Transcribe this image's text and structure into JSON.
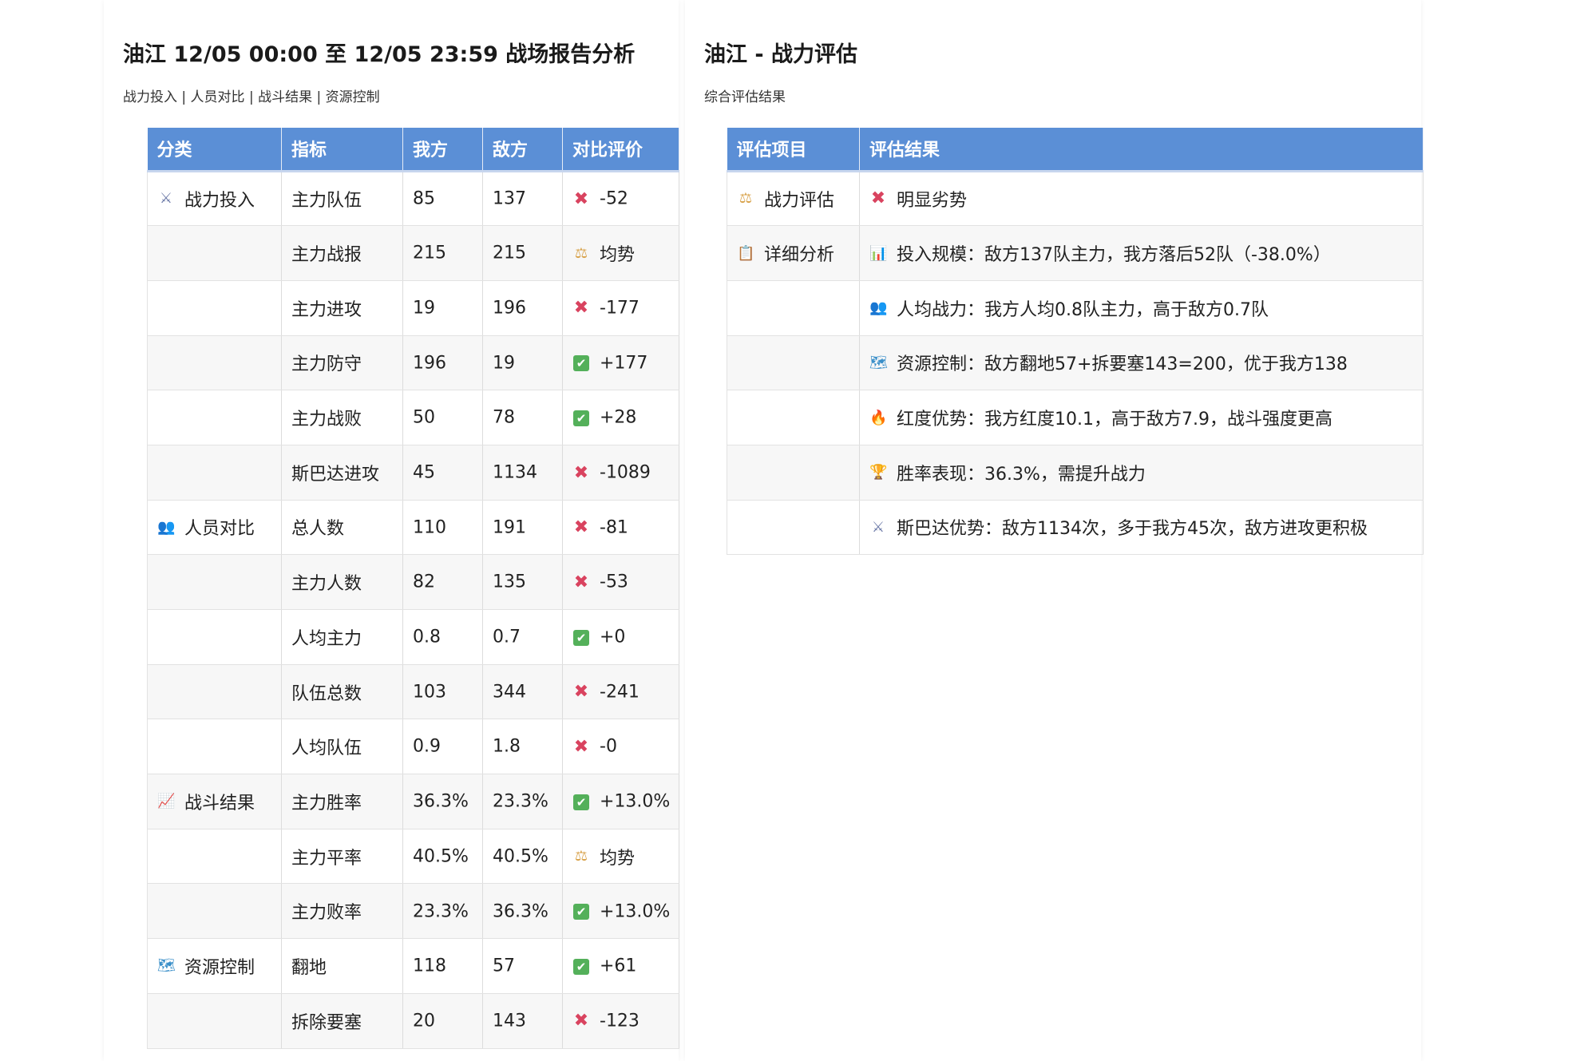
{
  "left": {
    "title": "油江 12/05 00:00 至 12/05 23:59 战场报告分析",
    "subtitle": "战力投入 | 人员对比 | 战斗结果 | 资源控制",
    "headers": [
      "分类",
      "指标",
      "我方",
      "敌方",
      "对比评价"
    ],
    "rows": [
      {
        "category": "战力投入",
        "category_icon": "crossed-swords-icon",
        "metric": "主力队伍",
        "ours": "85",
        "enemy": "137",
        "eval_icon": "cross-mark-icon",
        "eval": "-52"
      },
      {
        "category": "",
        "metric": "主力战报",
        "ours": "215",
        "enemy": "215",
        "eval_icon": "balance-scale-icon",
        "eval": "均势"
      },
      {
        "category": "",
        "metric": "主力进攻",
        "ours": "19",
        "enemy": "196",
        "eval_icon": "cross-mark-icon",
        "eval": "-177"
      },
      {
        "category": "",
        "metric": "主力防守",
        "ours": "196",
        "enemy": "19",
        "eval_icon": "check-mark-icon",
        "eval": "+177"
      },
      {
        "category": "",
        "metric": "主力战败",
        "ours": "50",
        "enemy": "78",
        "eval_icon": "check-mark-icon",
        "eval": "+28"
      },
      {
        "category": "",
        "metric": "斯巴达进攻",
        "ours": "45",
        "enemy": "1134",
        "eval_icon": "cross-mark-icon",
        "eval": "-1089"
      },
      {
        "category": "人员对比",
        "category_icon": "people-icon",
        "metric": "总人数",
        "ours": "110",
        "enemy": "191",
        "eval_icon": "cross-mark-icon",
        "eval": "-81"
      },
      {
        "category": "",
        "metric": "主力人数",
        "ours": "82",
        "enemy": "135",
        "eval_icon": "cross-mark-icon",
        "eval": "-53"
      },
      {
        "category": "",
        "metric": "人均主力",
        "ours": "0.8",
        "enemy": "0.7",
        "eval_icon": "check-mark-icon",
        "eval": "+0"
      },
      {
        "category": "",
        "metric": "队伍总数",
        "ours": "103",
        "enemy": "344",
        "eval_icon": "cross-mark-icon",
        "eval": "-241"
      },
      {
        "category": "",
        "metric": "人均队伍",
        "ours": "0.9",
        "enemy": "1.8",
        "eval_icon": "cross-mark-icon",
        "eval": "-0"
      },
      {
        "category": "战斗结果",
        "category_icon": "chart-increasing-icon",
        "metric": "主力胜率",
        "ours": "36.3%",
        "enemy": "23.3%",
        "eval_icon": "check-mark-icon",
        "eval": "+13.0%"
      },
      {
        "category": "",
        "metric": "主力平率",
        "ours": "40.5%",
        "enemy": "40.5%",
        "eval_icon": "balance-scale-icon",
        "eval": "均势"
      },
      {
        "category": "",
        "metric": "主力败率",
        "ours": "23.3%",
        "enemy": "36.3%",
        "eval_icon": "check-mark-icon",
        "eval": "+13.0%"
      },
      {
        "category": "资源控制",
        "category_icon": "world-map-icon",
        "metric": "翻地",
        "ours": "118",
        "enemy": "57",
        "eval_icon": "check-mark-icon",
        "eval": "+61"
      },
      {
        "category": "",
        "metric": "拆除要塞",
        "ours": "20",
        "enemy": "143",
        "eval_icon": "cross-mark-icon",
        "eval": "-123"
      }
    ]
  },
  "right": {
    "title": "油江 - 战力评估",
    "subtitle": "综合评估结果",
    "headers": [
      "评估项目",
      "评估结果"
    ],
    "rows": [
      {
        "item": "战力评估",
        "item_icon": "balance-scale-icon",
        "result_icon": "cross-mark-icon",
        "result": "明显劣势"
      },
      {
        "item": "详细分析",
        "item_icon": "clipboard-icon",
        "result_icon": "bar-chart-icon",
        "result": "投入规模：敌方137队主力，我方落后52队（-38.0%）"
      },
      {
        "item": "",
        "result_icon": "people-icon",
        "result": "人均战力：我方人均0.8队主力，高于敌方0.7队"
      },
      {
        "item": "",
        "result_icon": "world-map-icon",
        "result": "资源控制：敌方翻地57+拆要塞143=200，优于我方138"
      },
      {
        "item": "",
        "result_icon": "fire-icon",
        "result": "红度优势：我方红度10.1，高于敌方7.9，战斗强度更高"
      },
      {
        "item": "",
        "result_icon": "trophy-icon",
        "result": "胜率表现：36.3%，需提升战力"
      },
      {
        "item": "",
        "result_icon": "crossed-swords-icon",
        "result": "斯巴达优势：敌方1134次，多于我方45次，敌方进攻更积极"
      }
    ]
  },
  "colors": {
    "header_bg": "#5b8fd6",
    "cross": "#d9435f",
    "check": "#54b05a",
    "alt_row": "#f7f7f7"
  }
}
